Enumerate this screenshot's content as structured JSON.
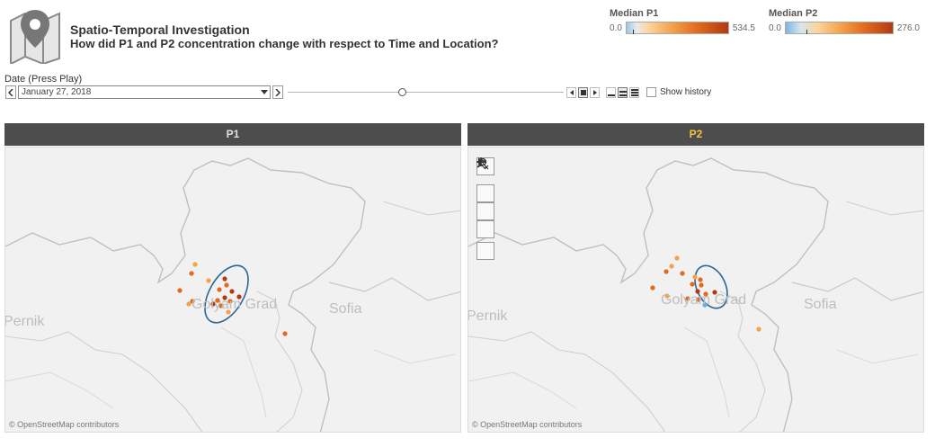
{
  "header": {
    "title": "Spatio-Temporal Investigation",
    "subtitle": "How did P1 and P2 concentration change with respect to Time and Location?"
  },
  "legends": [
    {
      "title": "Median P1",
      "min": "0.0",
      "max": "534.5",
      "marker_fraction": 0.06
    },
    {
      "title": "Median P2",
      "min": "0.0",
      "max": "276.0",
      "marker_fraction": 0.19
    }
  ],
  "date_control": {
    "label": "Date (Press Play)",
    "value": "January 27, 2018",
    "slider_fraction": 0.42,
    "show_history_label": "Show history",
    "show_history_checked": false
  },
  "panels": [
    {
      "title": "P1",
      "labels": {
        "city_left": "Pernik",
        "city_center": "Sofia",
        "city_overlap": "Golyam Grad"
      },
      "attribution": "© OpenStreetMap contributors",
      "tools": false
    },
    {
      "title": "P2",
      "labels": {
        "city_left": "Pernik",
        "city_center": "Sofia",
        "city_overlap": "Golyam Grad"
      },
      "attribution": "© OpenStreetMap contributors",
      "tools": true
    }
  ],
  "colors": {
    "header_bg": "#4d4d4d",
    "p1_title": "#e0e0e0",
    "p2_title": "#f2c33c",
    "marker_light": "#f5a04a",
    "marker_mid": "#e06a1d",
    "marker_dark": "#b23a12",
    "marker_blue": "#6aaee0",
    "ellipse": "#2a6796",
    "border_line": "#bfbfbf"
  },
  "icons": {
    "logo": "map-pin-icon",
    "search": "search-icon",
    "zoom_in": "plus-icon",
    "zoom_out": "minus-icon",
    "clear": "clear-selection-icon",
    "expand": "expand-arrow-icon"
  }
}
